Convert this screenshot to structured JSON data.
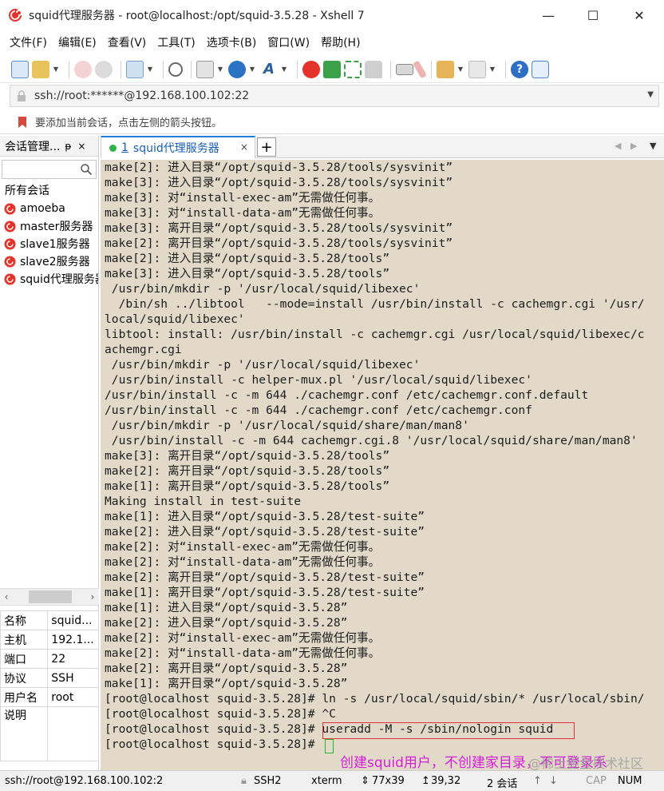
{
  "window": {
    "title": "squid代理服务器 - root@localhost:/opt/squid-3.5.28 - Xshell 7",
    "minimize": "—",
    "maximize": "☐",
    "close": "✕"
  },
  "menu": [
    "文件(F)",
    "编辑(E)",
    "查看(V)",
    "工具(T)",
    "选项卡(B)",
    "窗口(W)",
    "帮助(H)"
  ],
  "address": {
    "value": "ssh://root:******@192.168.100.102:22"
  },
  "hint": "要添加当前会话，点击左侧的箭头按钮。",
  "session_panel": {
    "title": "会话管理...",
    "pin": "ᵽ",
    "close": "×",
    "root": "所有会话",
    "items": [
      "amoeba",
      "master服务器",
      "slave1服务器",
      "slave2服务器",
      "squid代理服务器"
    ],
    "properties": [
      {
        "key": "名称",
        "value": "squid..."
      },
      {
        "key": "主机",
        "value": "192.1..."
      },
      {
        "key": "端口",
        "value": "22"
      },
      {
        "key": "协议",
        "value": "SSH"
      },
      {
        "key": "用户名",
        "value": "root"
      },
      {
        "key": "说明",
        "value": ""
      }
    ]
  },
  "tab": {
    "number": "1",
    "label": "squid代理服务器",
    "close": "×",
    "new": "+"
  },
  "terminal": {
    "lines": [
      "make[2]: 进入目录“/opt/squid-3.5.28/tools/sysvinit”",
      "make[3]: 进入目录“/opt/squid-3.5.28/tools/sysvinit”",
      "make[3]: 对“install-exec-am”无需做任何事。",
      "make[3]: 对“install-data-am”无需做任何事。",
      "make[3]: 离开目录“/opt/squid-3.5.28/tools/sysvinit”",
      "make[2]: 离开目录“/opt/squid-3.5.28/tools/sysvinit”",
      "make[2]: 进入目录“/opt/squid-3.5.28/tools”",
      "make[3]: 进入目录“/opt/squid-3.5.28/tools”",
      " /usr/bin/mkdir -p '/usr/local/squid/libexec'",
      "  /bin/sh ../libtool   --mode=install /usr/bin/install -c cachemgr.cgi '/usr/",
      "local/squid/libexec'",
      "libtool: install: /usr/bin/install -c cachemgr.cgi /usr/local/squid/libexec/c",
      "achemgr.cgi",
      " /usr/bin/mkdir -p '/usr/local/squid/libexec'",
      " /usr/bin/install -c helper-mux.pl '/usr/local/squid/libexec'",
      "/usr/bin/install -c -m 644 ./cachemgr.conf /etc/cachemgr.conf.default",
      "/usr/bin/install -c -m 644 ./cachemgr.conf /etc/cachemgr.conf",
      " /usr/bin/mkdir -p '/usr/local/squid/share/man/man8'",
      " /usr/bin/install -c -m 644 cachemgr.cgi.8 '/usr/local/squid/share/man/man8'",
      "make[3]: 离开目录“/opt/squid-3.5.28/tools”",
      "make[2]: 离开目录“/opt/squid-3.5.28/tools”",
      "make[1]: 离开目录“/opt/squid-3.5.28/tools”",
      "Making install in test-suite",
      "make[1]: 进入目录“/opt/squid-3.5.28/test-suite”",
      "make[2]: 进入目录“/opt/squid-3.5.28/test-suite”",
      "make[2]: 对“install-exec-am”无需做任何事。",
      "make[2]: 对“install-data-am”无需做任何事。",
      "make[2]: 离开目录“/opt/squid-3.5.28/test-suite”",
      "make[1]: 离开目录“/opt/squid-3.5.28/test-suite”",
      "make[1]: 进入目录“/opt/squid-3.5.28”",
      "make[2]: 进入目录“/opt/squid-3.5.28”",
      "make[2]: 对“install-exec-am”无需做任何事。",
      "make[2]: 对“install-data-am”无需做任何事。",
      "make[2]: 离开目录“/opt/squid-3.5.28”",
      "make[1]: 离开目录“/opt/squid-3.5.28”",
      "[root@localhost squid-3.5.28]# ln -s /usr/local/squid/sbin/* /usr/local/sbin/",
      "[root@localhost squid-3.5.28]# ^C",
      "[root@localhost squid-3.5.28]# useradd -M -s /sbin/nologin squid",
      "[root@localhost squid-3.5.28]# "
    ],
    "annotation": "创建squid用户，不创建家目录，不可登录系",
    "watermark": "@稀土掘金技术社区"
  },
  "status": {
    "address": "ssh://root@192.168.100.102:2",
    "protocol": "SSH2",
    "term": "xterm",
    "size": "77x39",
    "cursor_pos": "39,32",
    "sessions": "2 会话",
    "cap": "CAP",
    "num": "NUM"
  },
  "colors": {
    "terminal_bg": "#e2d9c9",
    "tab_accent": "#1e7fd6",
    "annotation": "#d41fd9",
    "highlight_border": "#e0323a",
    "cursor_border": "#2db52d"
  }
}
